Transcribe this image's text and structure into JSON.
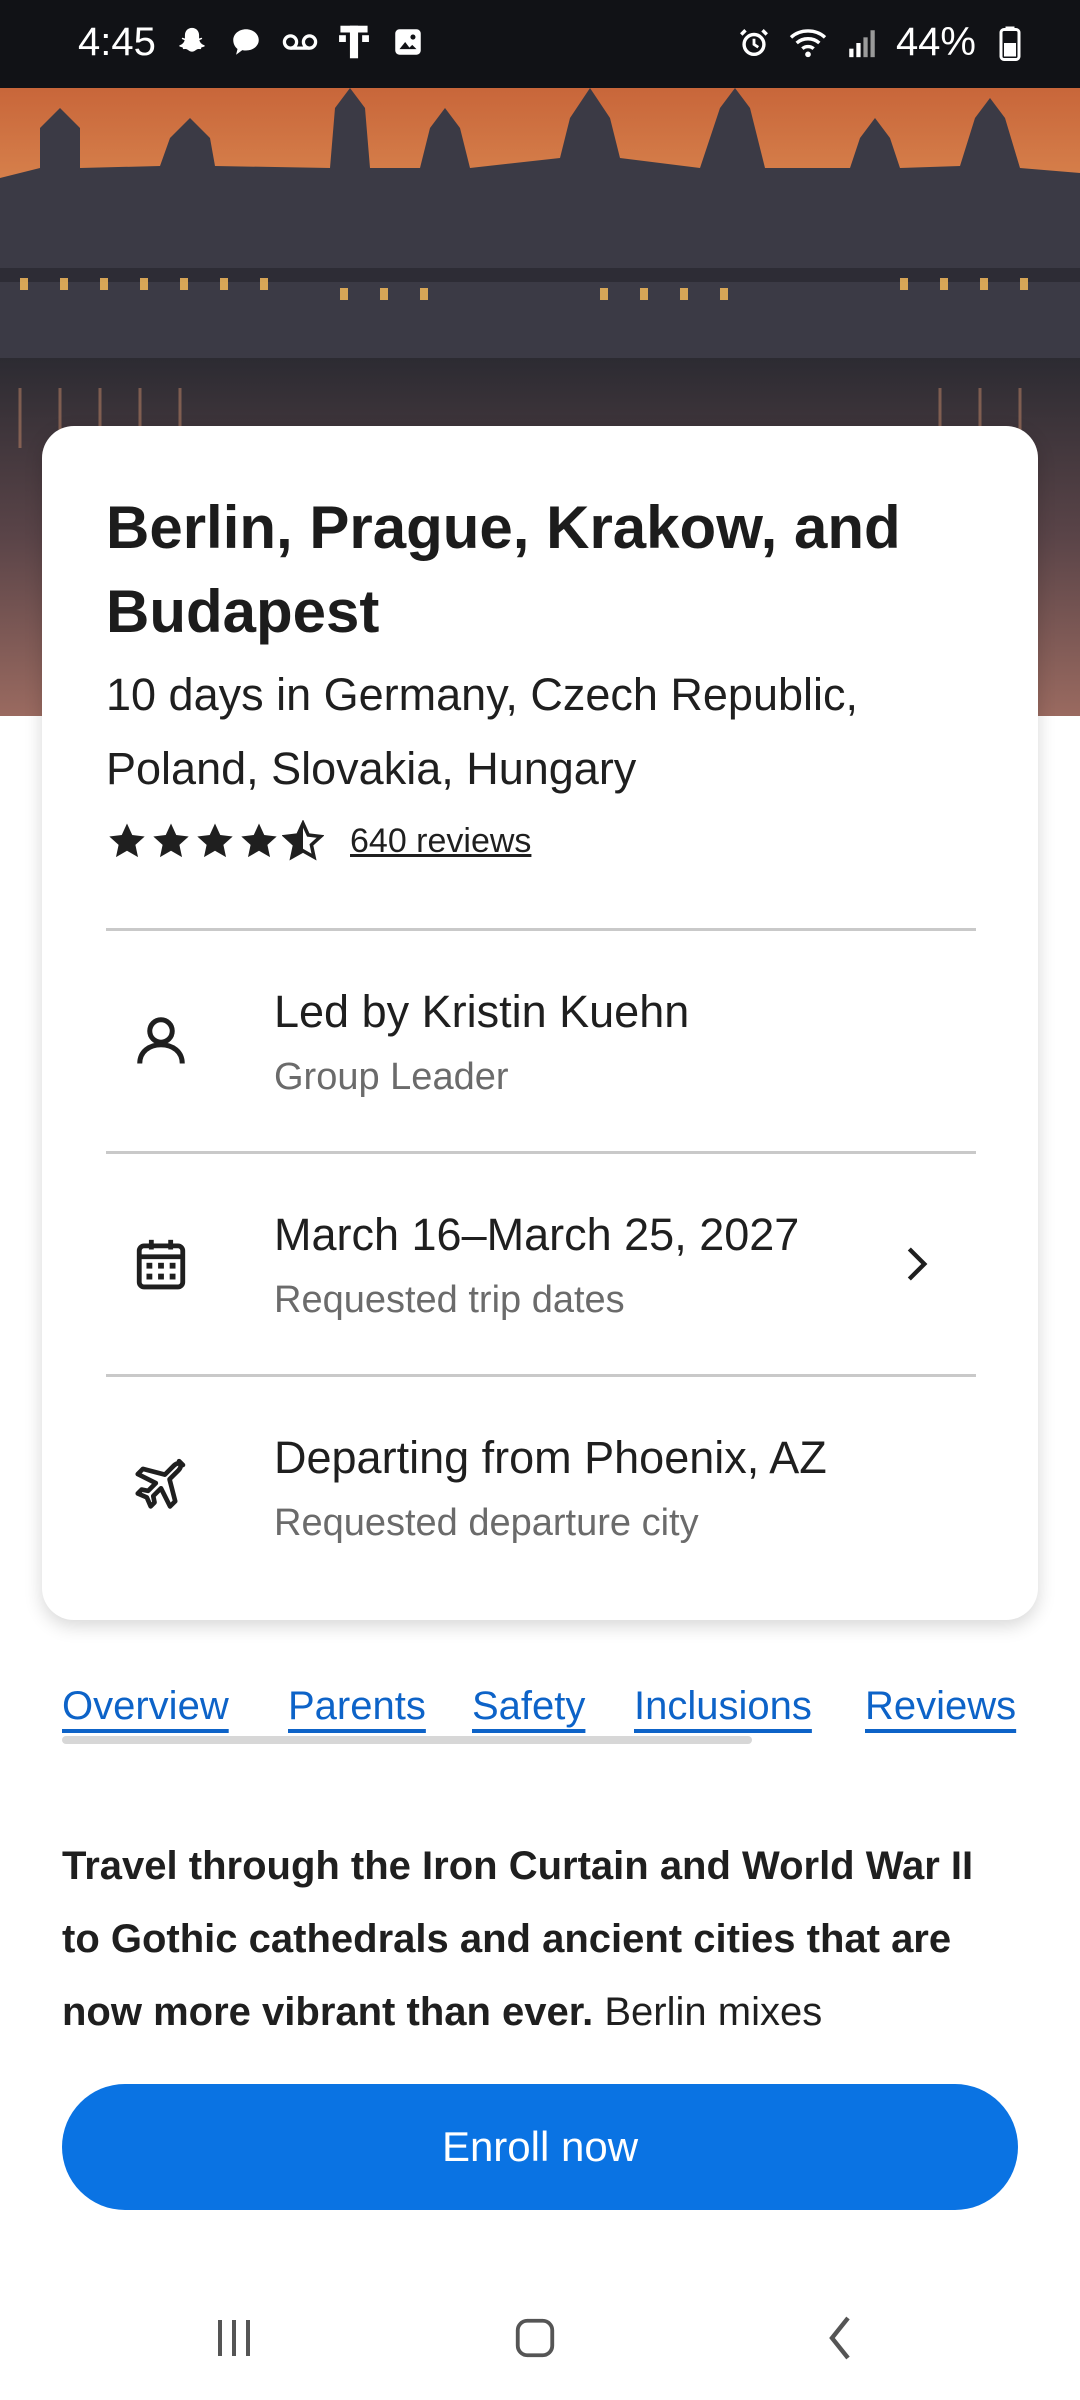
{
  "status_bar": {
    "time": "4:45",
    "battery": "44%",
    "left_icons": [
      "snapchat-icon",
      "chat-bubble-icon",
      "voicemail-icon",
      "tmobile-icon",
      "gallery-icon"
    ],
    "right_icons": [
      "alarm-icon",
      "wifi-icon",
      "signal-icon",
      "battery-icon"
    ]
  },
  "hero": {
    "image": "Hungarian Parliament at sunset"
  },
  "trip": {
    "title": "Berlin, Prague, Krakow, and Budapest",
    "subtitle": "10 days in Germany, Czech Republic, Poland, Slovakia, Hungary",
    "rating": 4.5,
    "reviews_label": "640 reviews"
  },
  "details": [
    {
      "icon": "person-icon",
      "title": "Led by Kristin Kuehn",
      "subtitle": "Group Leader"
    },
    {
      "icon": "calendar-icon",
      "title": "March 16–March 25, 2027",
      "subtitle": "Requested trip dates"
    },
    {
      "icon": "airplane-icon",
      "title": "Departing from Phoenix, AZ",
      "subtitle": "Requested departure city"
    }
  ],
  "tabs": [
    "Overview",
    "Parents",
    "Safety",
    "Inclusions",
    "Reviews"
  ],
  "description": {
    "bold": "Travel through the Iron Curtain and World War II to Gothic cathedrals and ancient cities that are now more vibrant than ever.",
    "normal": " Berlin mixes"
  },
  "cta": {
    "label": "Enroll now"
  },
  "colors": {
    "accent": "#0a73e3",
    "link": "#0d63c8",
    "statusbar": "#111216"
  }
}
